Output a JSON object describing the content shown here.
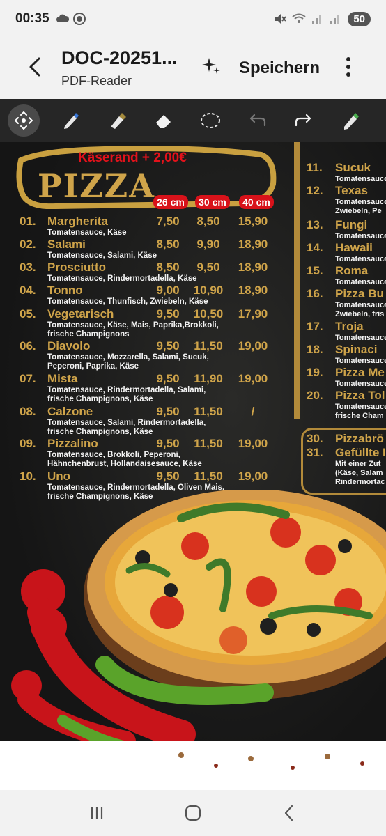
{
  "status": {
    "time": "00:35",
    "battery": "50"
  },
  "header": {
    "title": "DOC-20251...",
    "subtitle": "PDF-Reader",
    "save_label": "Speichern"
  },
  "toolbar": {
    "icons": [
      "move-icon",
      "pen-icon",
      "highlighter-icon",
      "eraser-icon",
      "lasso-icon",
      "undo-icon",
      "redo-icon",
      "pencil-icon"
    ]
  },
  "menu": {
    "kaserand": "Käserand + 2,00€",
    "title": "PIZZA",
    "sizes": [
      "26 cm",
      "30 cm",
      "40 cm"
    ],
    "items": [
      {
        "num": "01.",
        "name": "Margherita",
        "p1": "7,50",
        "p2": "8,50",
        "p3": "15,90",
        "desc": "Tomatensauce, Käse"
      },
      {
        "num": "02.",
        "name": "Salami",
        "p1": "8,50",
        "p2": "9,90",
        "p3": "18,90",
        "desc": "Tomatensauce, Salami, Käse"
      },
      {
        "num": "03.",
        "name": "Prosciutto",
        "p1": "8,50",
        "p2": "9,50",
        "p3": "18,90",
        "desc": "Tomatensauce, Rindermortadella, Käse"
      },
      {
        "num": "04.",
        "name": "Tonno",
        "p1": "9,00",
        "p2": "10,90",
        "p3": "18,90",
        "desc": "Tomatensauce, Thunfisch, Zwiebeln, Käse"
      },
      {
        "num": "05.",
        "name": "Vegetarisch",
        "p1": "9,50",
        "p2": "10,50",
        "p3": "17,90",
        "desc": "Tomatensauce, Käse, Mais, Paprika,Brokkoli, frische Champignons"
      },
      {
        "num": "06.",
        "name": "Diavolo",
        "p1": "9,50",
        "p2": "11,50",
        "p3": "19,00",
        "desc": "Tomatensauce, Mozzarella, Salami, Sucuk, Peperoni, Paprika, Käse"
      },
      {
        "num": "07.",
        "name": "Mista",
        "p1": "9,50",
        "p2": "11,90",
        "p3": "19,00",
        "desc": "Tomatensauce, Rindermortadella, Salami, frische Champignons, Käse"
      },
      {
        "num": "08.",
        "name": "Calzone",
        "p1": "9,50",
        "p2": "11,50",
        "p3": "/",
        "desc": "Tomatensauce, Salami, Rindermortadella, frische Champignons, Käse"
      },
      {
        "num": "09.",
        "name": "Pizzalino",
        "p1": "9,50",
        "p2": "11,50",
        "p3": "19,00",
        "desc": "Tomatensauce, Brokkoli, Peperoni, Hähnchenbrust, Hollandaisesauce, Käse"
      },
      {
        "num": "10.",
        "name": "Uno",
        "p1": "9,50",
        "p2": "11,50",
        "p3": "19,00",
        "desc": "Tomatensauce, Rindermortadella, Oliven Mais, frische Champignons, Käse"
      }
    ],
    "right_items": [
      {
        "num": "11.",
        "name": "Sucuk",
        "desc": "Tomatensauce"
      },
      {
        "num": "12.",
        "name": "Texas",
        "desc": "Tomatensauce\nZwiebeln, Pe"
      },
      {
        "num": "13.",
        "name": "Fungi",
        "desc": "Tomatensauce"
      },
      {
        "num": "14.",
        "name": "Hawaii",
        "desc": "Tomatensauce"
      },
      {
        "num": "15.",
        "name": "Roma",
        "desc": "Tomatensauce"
      },
      {
        "num": "16.",
        "name": "Pizza Bu",
        "desc": "Tomatensauce\nZwiebeln, fris"
      },
      {
        "num": "17.",
        "name": "Troja",
        "desc": "Tomatensauce"
      },
      {
        "num": "18.",
        "name": "Spinaci",
        "desc": "Tomatensauce"
      },
      {
        "num": "19.",
        "name": "Pizza Me",
        "desc": "Tomatensauce"
      },
      {
        "num": "20.",
        "name": "Pizza Tol",
        "desc": "Tomatensauce\nfrische Cham"
      }
    ],
    "box_items": [
      {
        "num": "30.",
        "name": "Pizzabrö"
      },
      {
        "num": "31.",
        "name": "Gefüllte I"
      }
    ],
    "box_desc": "Mit einer Zut\n(Käse, Salam\nRindermortac"
  }
}
